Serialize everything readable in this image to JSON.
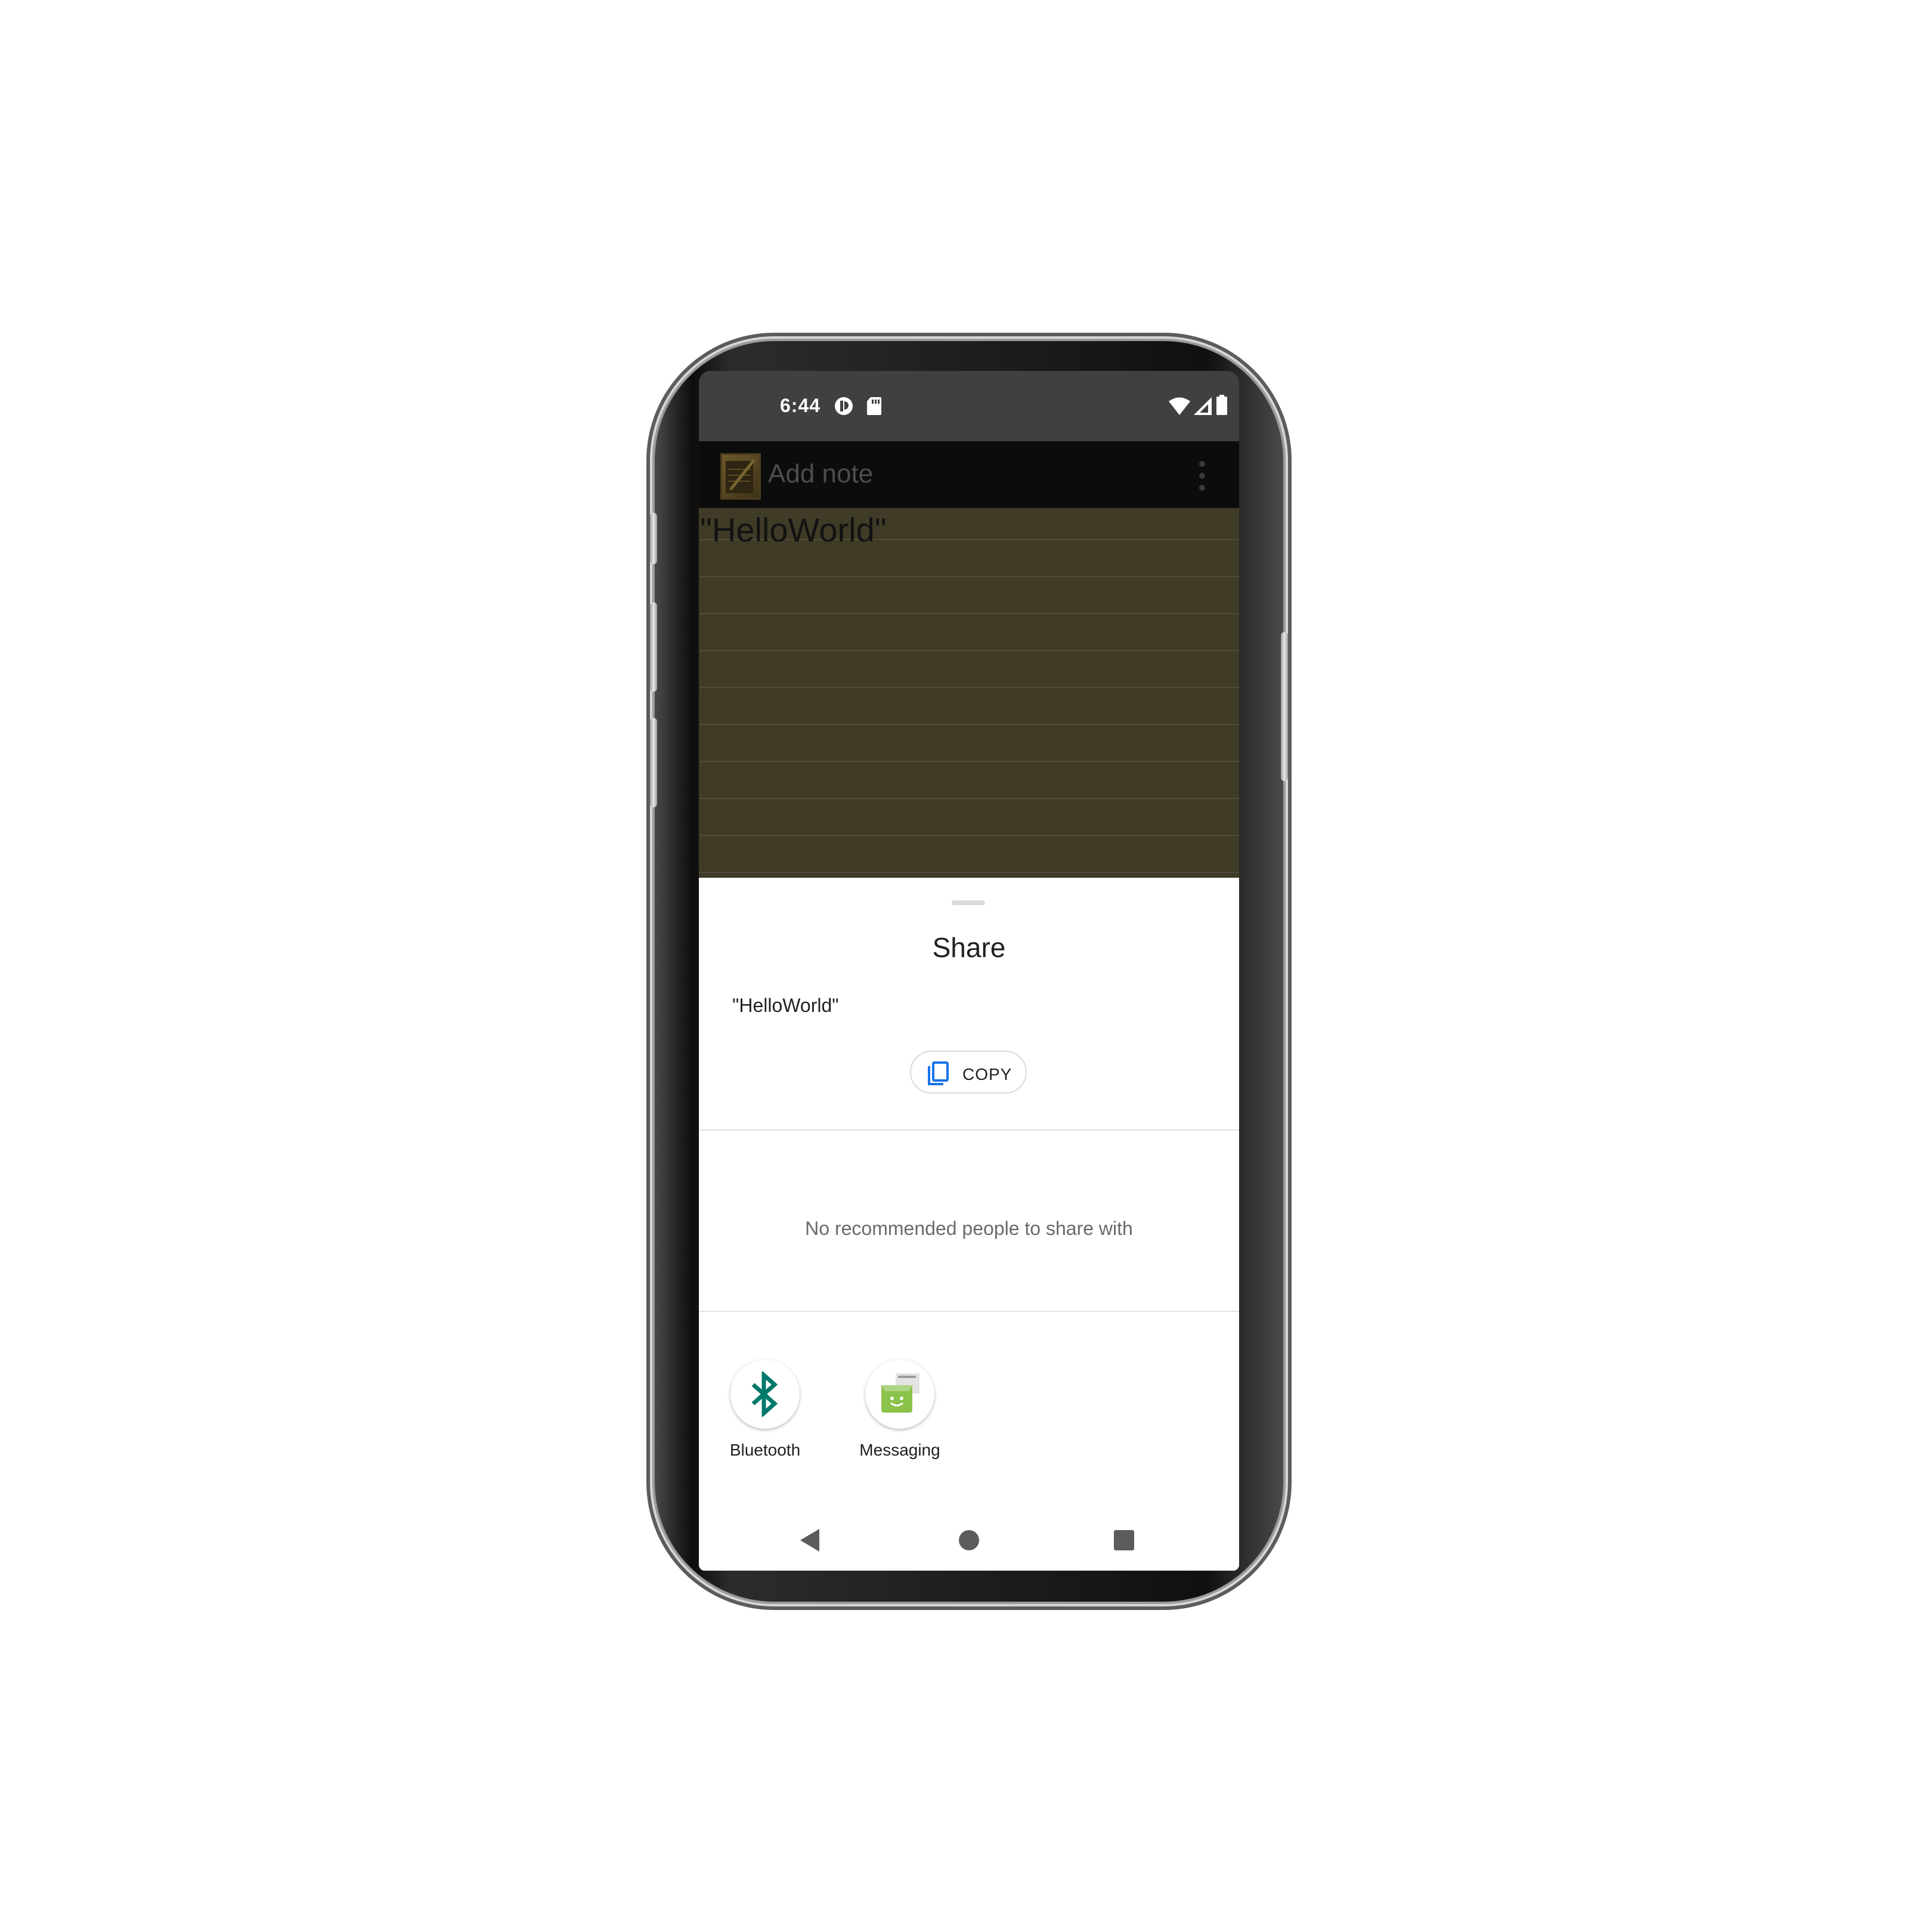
{
  "status_bar": {
    "time": "6:44",
    "icons_left": [
      "play-protect-icon",
      "sd-card-icon"
    ],
    "icons_right": [
      "wifi-icon",
      "signal-icon",
      "battery-icon"
    ]
  },
  "app_bar": {
    "title": "Add note",
    "menu_icon": "overflow-menu-icon"
  },
  "note": {
    "text": "\"HelloWorld\""
  },
  "share_sheet": {
    "title": "Share",
    "preview_text": "\"HelloWorld\"",
    "copy_label": "COPY",
    "no_recommendations": "No recommended people to share with",
    "targets": [
      {
        "label": "Bluetooth",
        "icon": "bluetooth-icon",
        "color": "#00796b"
      },
      {
        "label": "Messaging",
        "icon": "messaging-icon",
        "color": "#8bc34a"
      }
    ]
  },
  "nav_bar": {
    "buttons": [
      "back-icon",
      "home-icon",
      "recents-icon"
    ]
  },
  "colors": {
    "status_bar": "#404040",
    "app_bar": "#0c0c0c",
    "note_background": "#3f3b26",
    "copy_icon": "#1a73e8"
  }
}
